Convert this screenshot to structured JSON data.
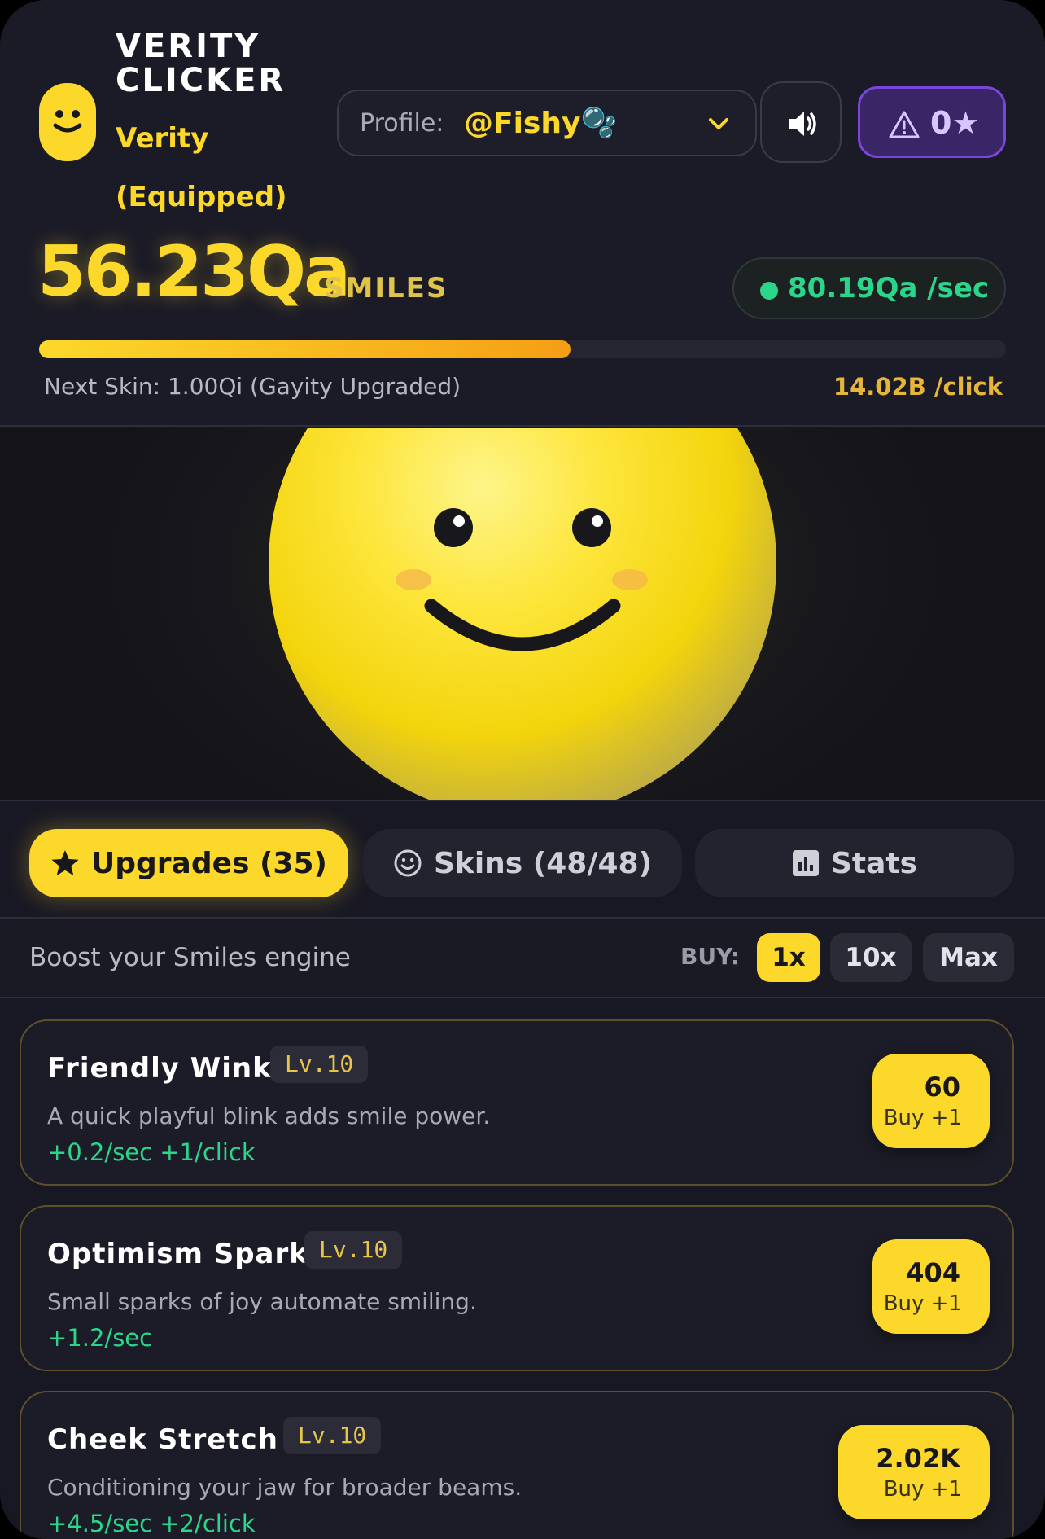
{
  "header": {
    "brand_title": "VERITY CLICKER",
    "equipped_skin": "Verity (Equipped)",
    "profile_label": "Profile:",
    "profile_value": "@Fishy🫧",
    "alert_count": "0★"
  },
  "stats": {
    "score": "56.23Qa",
    "score_unit": "SMILES",
    "rate": "80.19Qa /sec",
    "progress_fraction": 0.55,
    "next_skin": "Next Skin: 1.00Qi (Gayity Upgraded)",
    "per_click": "14.02B /click"
  },
  "tabs": [
    {
      "label": "Upgrades (35)",
      "icon": "star-icon",
      "active": true
    },
    {
      "label": "Skins (48/48)",
      "icon": "smiley-icon",
      "active": false
    },
    {
      "label": "Stats",
      "icon": "bar-chart-icon",
      "active": false
    }
  ],
  "buybar": {
    "text": "Boost your Smiles engine",
    "buy_label": "BUY:",
    "options": [
      "1x",
      "10x",
      "Max"
    ],
    "selected": "1x"
  },
  "upgrades": [
    {
      "title": "Friendly Wink",
      "level": "Lv.10",
      "desc": "A quick playful blink adds smile power.",
      "effect": "+0.2/sec +1/click",
      "price": "60",
      "buy": "Buy +1"
    },
    {
      "title": "Optimism Spark",
      "level": "Lv.10",
      "desc": "Small sparks of joy automate smiling.",
      "effect": "+1.2/sec",
      "price": "404",
      "buy": "Buy +1"
    },
    {
      "title": "Cheek Stretch",
      "level": "Lv.10",
      "desc": "Conditioning your jaw for broader beams.",
      "effect": "+4.5/sec +2/click",
      "price": "2.02K",
      "buy": "Buy +1"
    }
  ],
  "colors": {
    "accent": "#fcd82b",
    "positive": "#2bd68a",
    "alert_purple": "#7b45d9",
    "background": "#181824"
  }
}
